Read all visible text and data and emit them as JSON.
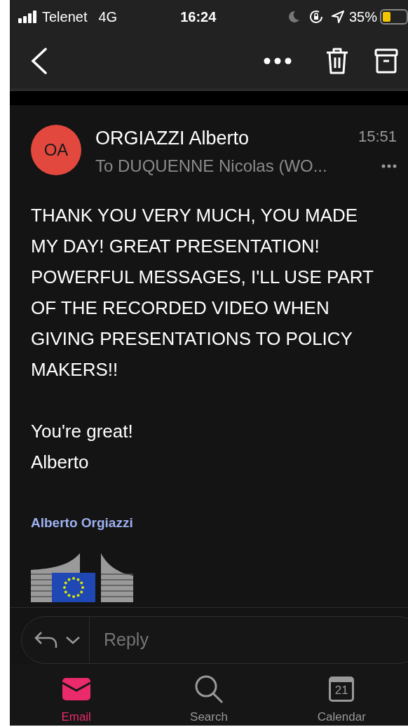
{
  "status_bar": {
    "carrier": "Telenet",
    "network": "4G",
    "time": "16:24",
    "battery": "35%"
  },
  "message": {
    "avatar": "OA",
    "sender": "ORGIAZZI Alberto",
    "time": "15:51",
    "recipients": "To DUQUENNE Nicolas (WO...",
    "body": [
      "THANK YOU VERY MUCH, YOU MADE MY DAY! GREAT PRESENTATION! POWERFUL MESSAGES, I'LL USE PART OF THE RECORDED VIDEO WHEN GIVING PRESENTATIONS TO POLICY MAKERS!!",
      "You're great!\nAlberto"
    ],
    "signature": "Alberto Orgiazzi"
  },
  "reply": {
    "placeholder": "Reply"
  },
  "tabs": [
    {
      "kind": "email",
      "label": "Email",
      "selected": true
    },
    {
      "kind": "search",
      "label": "Search",
      "selected": false
    },
    {
      "kind": "calendar",
      "label": "Calendar",
      "selected": false,
      "day": "21"
    }
  ]
}
